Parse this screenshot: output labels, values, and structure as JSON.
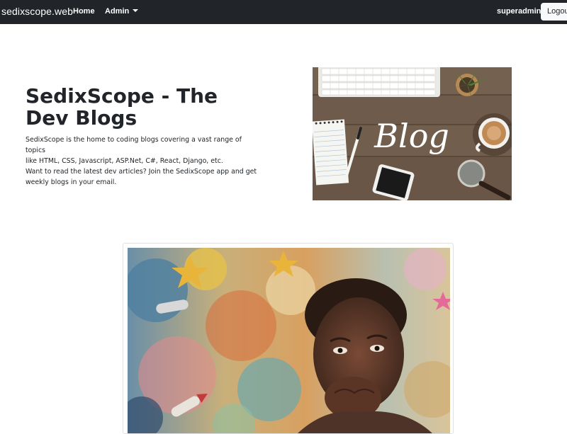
{
  "navbar": {
    "brand": "sedixscope.web",
    "links": [
      {
        "label": "Home"
      },
      {
        "label": "Admin"
      }
    ],
    "username": "superadmin",
    "logout_label": "Logout"
  },
  "hero": {
    "title": "SedixScope - The Dev Blogs",
    "description_lines": [
      "SedixScope is the home to coding blogs covering a vast range of topics",
      "like HTML, CSS, Javascript, ASP.Net, C#, React, Django, etc.",
      "Want to read the latest dev articles? Join the SedixScope app and get",
      "weekly blogs in your email."
    ]
  },
  "blog_image": {
    "script_text": "Blog"
  },
  "colors": {
    "navbar_bg": "#212529",
    "navbar_text": "#ffffff",
    "button_bg": "#f8f9fa",
    "body_text": "#212529"
  }
}
